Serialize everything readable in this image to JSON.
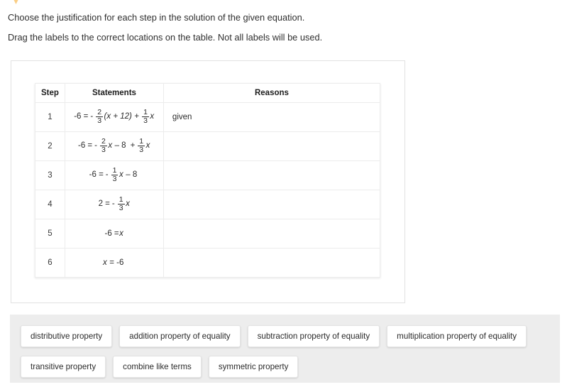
{
  "instructions": [
    "Choose the justification for each step in the solution of the given equation.",
    "Drag the labels to the correct locations on the table. Not all labels will be used."
  ],
  "table": {
    "headers": {
      "step": "Step",
      "statements": "Statements",
      "reasons": "Reasons"
    },
    "rows": [
      {
        "step": "1",
        "statement_text": "-6 = -2/3(x + 12) + 1/3x",
        "statement": {
          "lead": "-6 =",
          "sign": "-",
          "frac1": {
            "num": "2",
            "den": "3"
          },
          "mid": "(x + 12)",
          "plus": "+",
          "frac2": {
            "num": "1",
            "den": "3"
          },
          "tail": "x"
        },
        "reason": "given"
      },
      {
        "step": "2",
        "statement_text": "-6 = -2/3x - 8 + 1/3x",
        "statement": {
          "lead": "-6 =",
          "sign": "-",
          "frac1": {
            "num": "2",
            "den": "3"
          },
          "mid": "x",
          "minus": "– 8",
          "plus": "+",
          "frac2": {
            "num": "1",
            "den": "3"
          },
          "tail": "x"
        },
        "reason": ""
      },
      {
        "step": "3",
        "statement_text": "-6 = -1/3x - 8",
        "statement": {
          "lead": "-6 =",
          "sign": "-",
          "frac1": {
            "num": "1",
            "den": "3"
          },
          "mid": "x",
          "minus": "– 8"
        },
        "reason": ""
      },
      {
        "step": "4",
        "statement_text": "2 = -1/3x",
        "statement": {
          "lead": "2 =",
          "sign": "-",
          "frac1": {
            "num": "1",
            "den": "3"
          },
          "mid": "x"
        },
        "reason": ""
      },
      {
        "step": "5",
        "statement_text": "-6 = x",
        "statement": {
          "lead": "-6 =",
          "mid": "x"
        },
        "reason": ""
      },
      {
        "step": "6",
        "statement_text": "x = -6",
        "statement": {
          "lead": "",
          "mid": "x",
          "tailplain": "= -6"
        },
        "reason": ""
      }
    ]
  },
  "label_tray": {
    "row1": [
      "distributive property",
      "addition property of equality",
      "subtraction property of equality",
      "multiplication property of equality"
    ],
    "row2": [
      "transitive property",
      "combine like terms",
      "symmetric property"
    ]
  },
  "colors": {
    "page_background": "#ffffff",
    "tray_background": "#ededed",
    "chip_background": "#ffffff",
    "table_border": "#ececec",
    "card_border": "#e2e2e2",
    "text": "#2b2b2b",
    "marker": "#f5a623"
  }
}
